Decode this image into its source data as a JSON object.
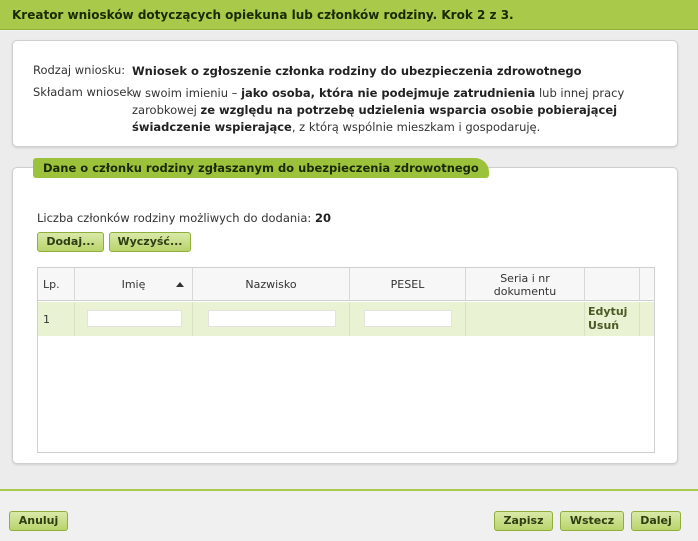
{
  "title": "Kreator wniosków dotyczących opiekuna lub członków rodziny. Krok 2 z 3.",
  "summary": {
    "type_label": "Rodzaj wniosku:",
    "type_value": "Wniosek o zgłoszenie członka rodziny do ubezpieczenia zdrowotnego",
    "submit_label": "Składam wniosek",
    "submit_part1": "w swoim imieniu – ",
    "submit_bold1": "jako osoba, która nie podejmuje zatrudnienia",
    "submit_part2": " lub innej pracy zarobkowej ",
    "submit_bold2": "ze względu na potrzebę udzielenia wsparcia osobie pobierającej świadczenie wspierające",
    "submit_part3": ", z którą wspólnie mieszkam i gospodaruję."
  },
  "section": {
    "header": "Dane o członku rodziny zgłaszanym do ubezpieczenia zdrowotnego",
    "count_label": "Liczba członków rodziny możliwych do dodania:",
    "count_value": "20",
    "add_button": "Dodaj...",
    "clear_button": "Wyczyść..."
  },
  "table": {
    "columns": [
      "Lp.",
      "Imię",
      "Nazwisko",
      "PESEL",
      "Seria i nr dokumentu",
      ""
    ],
    "sort_column": "Imię",
    "rows": [
      {
        "lp": "1",
        "imie": "",
        "nazwisko": "",
        "pesel": "",
        "dokument": "",
        "edit": "Edytuj",
        "delete": "Usuń"
      }
    ]
  },
  "footer": {
    "cancel": "Anuluj",
    "save": "Zapisz",
    "back": "Wstecz",
    "next": "Dalej"
  },
  "colors": {
    "accent": "#a8c94a",
    "row_highlight": "#e9f2d3"
  }
}
